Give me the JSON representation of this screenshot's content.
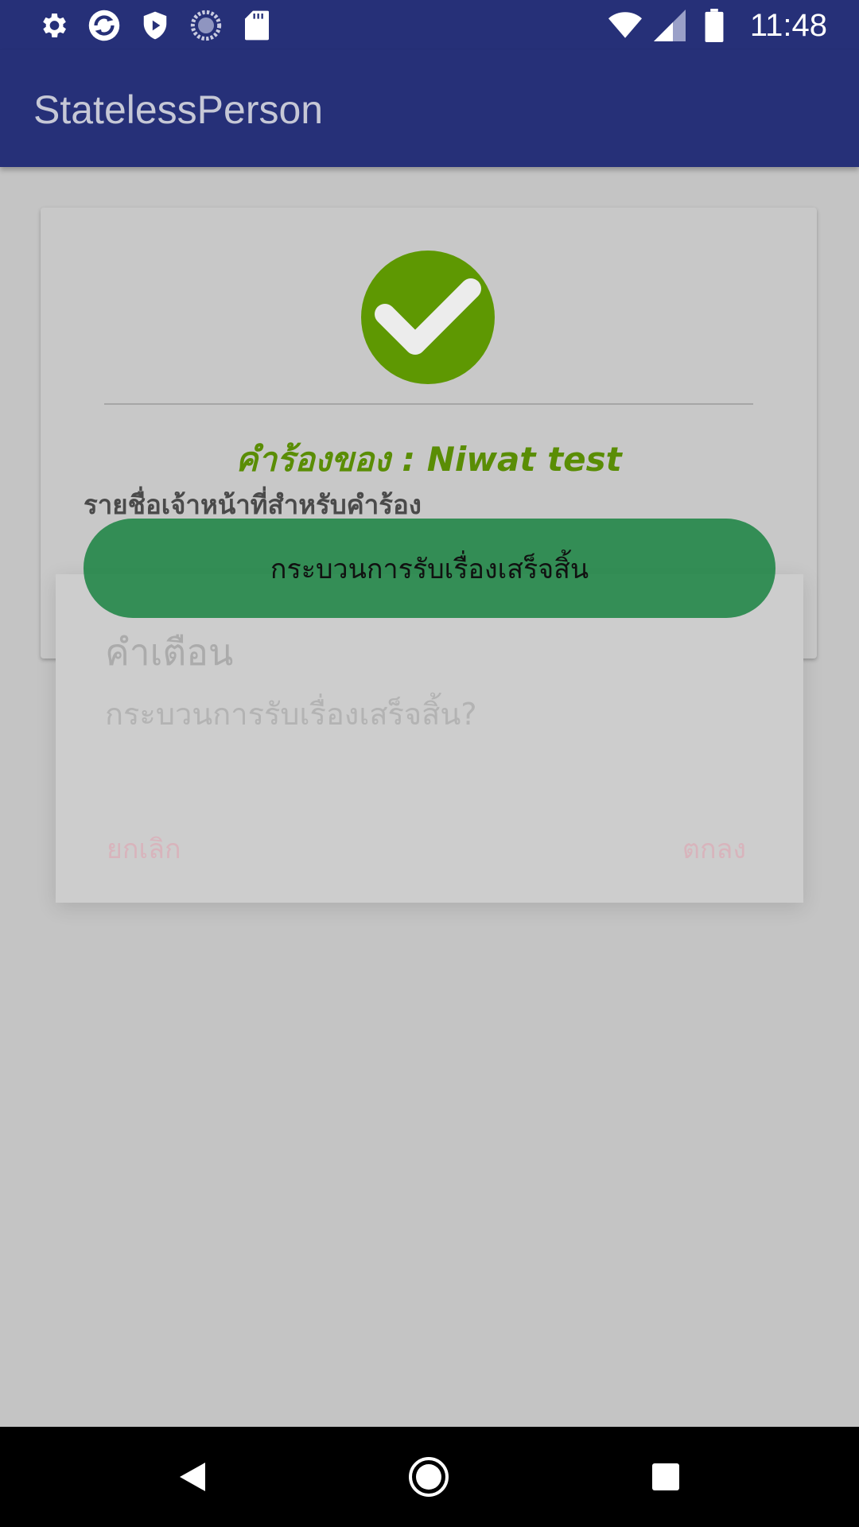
{
  "status_bar": {
    "time": "11:48",
    "left_icons": [
      "settings-icon",
      "sync-icon",
      "shield-play-icon",
      "loading-circle-icon",
      "sd-card-icon"
    ],
    "right_icons": [
      "wifi-icon",
      "signal-icon",
      "battery-icon"
    ]
  },
  "app_bar": {
    "title": "StatelessPerson"
  },
  "card": {
    "status_icon": "check-circle-icon",
    "request_of": "คำร้องของ : Niwat test",
    "officers_label": "รายชื่อเจ้าหน้าที่สำหรับคำร้อง",
    "finish_button_label": "กระบวนการรับเรื่องเสร็จสิ้น"
  },
  "dialog": {
    "title": "คำเตือน",
    "message": "กระบวนการรับเรื่องเสร็จสิ้น?",
    "cancel_label": "ยกเลิก",
    "ok_label": "ตกลง"
  },
  "nav_bar": {
    "buttons": [
      "back-icon",
      "home-icon",
      "recent-apps-icon"
    ]
  },
  "colors": {
    "primary": "#263078",
    "accent_green": "#5a8d05",
    "button_green": "#1d8a4b",
    "dialog_button": "#d8b4bc"
  }
}
